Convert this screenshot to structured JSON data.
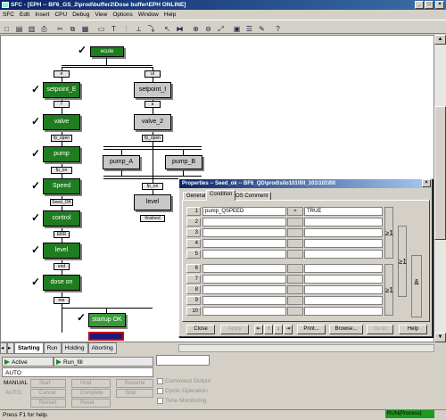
{
  "window": {
    "title": "SFC - [EPH -- BF6_GS_2\\prod\\buffer2\\Dose buffer\\EPH ONLINE]",
    "min_glyph": "_",
    "max_glyph": "□",
    "close_glyph": "×"
  },
  "menu": [
    "SFC",
    "Edit",
    "Insert",
    "CPU",
    "Debug",
    "View",
    "Options",
    "Window",
    "Help"
  ],
  "toolbar_icons": [
    "new-icon",
    "open-icon",
    "save-icon",
    "print-icon",
    "cut-icon",
    "copy-icon",
    "paste-icon",
    "step-icon",
    "transition-icon",
    "text-icon",
    "branch-icon",
    "jump-icon",
    "select-icon",
    "link-icon",
    "zoom-in-icon",
    "zoom-out-icon",
    "fit-icon",
    "properties-icon",
    "table-icon",
    "edit-icon",
    "help-icon"
  ],
  "toolbar_glyphs": [
    "□",
    "▤",
    "▥",
    "⎙",
    "✂",
    "⧉",
    "▦",
    "▭",
    "T",
    "⫶",
    "⟂",
    "⤵",
    "↖",
    "⧓",
    "⊕",
    "⊖",
    "⤢",
    "▣",
    "☰",
    "✎",
    "?"
  ],
  "sfc": {
    "initial_step": "ecute",
    "left_steps": [
      "setpoint_E",
      "valve",
      "pump",
      "Speed",
      "control",
      "level",
      "dose on"
    ],
    "left_transitions": [
      "e",
      "f",
      "fp_open",
      "fp_on",
      "Seed_OK",
      "ERR",
      "end",
      "me"
    ],
    "right_steps": [
      "setpoint_I",
      "valve_2",
      "pump_A",
      "pump_B",
      "level"
    ],
    "right_transitions": [
      "ul",
      "a",
      "fp_open",
      "fp_on",
      "finished"
    ],
    "final_step": "startup OK"
  },
  "sheet_tabs": [
    "Starting",
    "Run",
    "Holding",
    "Aborting"
  ],
  "control": {
    "active_label": "Active",
    "run_label": "Run_fill",
    "auto_label": "AUTO",
    "manual_label": "MANUAL",
    "auto_btn": "AUTO",
    "buttons": [
      "Start",
      "Hold",
      "Resume",
      "Cancel",
      "Complete",
      "Stop",
      "Restart",
      "Reset"
    ],
    "checkboxes": [
      "Command Output",
      "Cyclic Operation",
      "Time Monitoring"
    ]
  },
  "status": {
    "help": "Press F1 for help.",
    "run": "RUN(Process)"
  },
  "dialog": {
    "title": "Properties -- Seed_ok -- BF6_QD\\prod\\silo101\\fill_101\\101\\fill",
    "tabs": [
      "General",
      "Condition",
      "OS Comment"
    ],
    "rows": [
      {
        "n": "1",
        "operand": "pump_QSPEED",
        "op": "=",
        "value": "TRUE"
      },
      {
        "n": "2",
        "operand": "",
        "op": "",
        "value": ""
      },
      {
        "n": "3",
        "operand": "",
        "op": "",
        "value": ""
      },
      {
        "n": "4",
        "operand": "",
        "op": "",
        "value": ""
      },
      {
        "n": "5",
        "operand": "",
        "op": "",
        "value": ""
      },
      {
        "n": "6",
        "operand": "",
        "op": "",
        "value": ""
      },
      {
        "n": "7",
        "operand": "",
        "op": "",
        "value": ""
      },
      {
        "n": "8",
        "operand": "",
        "op": "",
        "value": ""
      },
      {
        "n": "9",
        "operand": "",
        "op": "",
        "value": ""
      },
      {
        "n": "10",
        "operand": "",
        "op": "",
        "value": ""
      }
    ],
    "logic": {
      "or1": "≥1",
      "or2": "≥1",
      "or3": "≥1",
      "and": "&"
    },
    "buttons": [
      "Close",
      "Apply",
      "Print...",
      "Browse...",
      "Go to",
      "Help"
    ],
    "nav": [
      "⇤",
      "↑",
      "↓",
      "⇥"
    ]
  }
}
